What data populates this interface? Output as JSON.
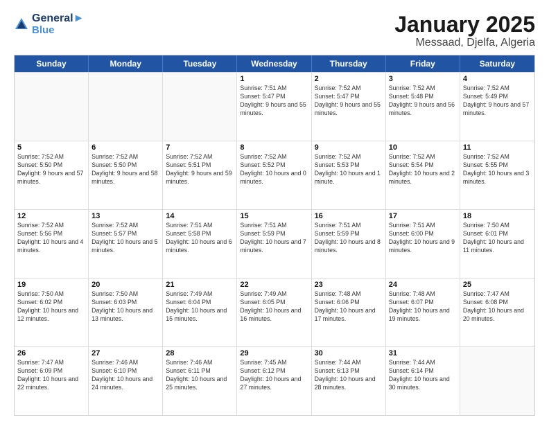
{
  "header": {
    "logo_line1": "General",
    "logo_line2": "Blue",
    "title": "January 2025",
    "subtitle": "Messaad, Djelfa, Algeria"
  },
  "weekdays": [
    "Sunday",
    "Monday",
    "Tuesday",
    "Wednesday",
    "Thursday",
    "Friday",
    "Saturday"
  ],
  "rows": [
    [
      {
        "day": "",
        "sunrise": "",
        "sunset": "",
        "daylight": ""
      },
      {
        "day": "",
        "sunrise": "",
        "sunset": "",
        "daylight": ""
      },
      {
        "day": "",
        "sunrise": "",
        "sunset": "",
        "daylight": ""
      },
      {
        "day": "1",
        "sunrise": "Sunrise: 7:51 AM",
        "sunset": "Sunset: 5:47 PM",
        "daylight": "Daylight: 9 hours and 55 minutes."
      },
      {
        "day": "2",
        "sunrise": "Sunrise: 7:52 AM",
        "sunset": "Sunset: 5:47 PM",
        "daylight": "Daylight: 9 hours and 55 minutes."
      },
      {
        "day": "3",
        "sunrise": "Sunrise: 7:52 AM",
        "sunset": "Sunset: 5:48 PM",
        "daylight": "Daylight: 9 hours and 56 minutes."
      },
      {
        "day": "4",
        "sunrise": "Sunrise: 7:52 AM",
        "sunset": "Sunset: 5:49 PM",
        "daylight": "Daylight: 9 hours and 57 minutes."
      }
    ],
    [
      {
        "day": "5",
        "sunrise": "Sunrise: 7:52 AM",
        "sunset": "Sunset: 5:50 PM",
        "daylight": "Daylight: 9 hours and 57 minutes."
      },
      {
        "day": "6",
        "sunrise": "Sunrise: 7:52 AM",
        "sunset": "Sunset: 5:50 PM",
        "daylight": "Daylight: 9 hours and 58 minutes."
      },
      {
        "day": "7",
        "sunrise": "Sunrise: 7:52 AM",
        "sunset": "Sunset: 5:51 PM",
        "daylight": "Daylight: 9 hours and 59 minutes."
      },
      {
        "day": "8",
        "sunrise": "Sunrise: 7:52 AM",
        "sunset": "Sunset: 5:52 PM",
        "daylight": "Daylight: 10 hours and 0 minutes."
      },
      {
        "day": "9",
        "sunrise": "Sunrise: 7:52 AM",
        "sunset": "Sunset: 5:53 PM",
        "daylight": "Daylight: 10 hours and 1 minute."
      },
      {
        "day": "10",
        "sunrise": "Sunrise: 7:52 AM",
        "sunset": "Sunset: 5:54 PM",
        "daylight": "Daylight: 10 hours and 2 minutes."
      },
      {
        "day": "11",
        "sunrise": "Sunrise: 7:52 AM",
        "sunset": "Sunset: 5:55 PM",
        "daylight": "Daylight: 10 hours and 3 minutes."
      }
    ],
    [
      {
        "day": "12",
        "sunrise": "Sunrise: 7:52 AM",
        "sunset": "Sunset: 5:56 PM",
        "daylight": "Daylight: 10 hours and 4 minutes."
      },
      {
        "day": "13",
        "sunrise": "Sunrise: 7:52 AM",
        "sunset": "Sunset: 5:57 PM",
        "daylight": "Daylight: 10 hours and 5 minutes."
      },
      {
        "day": "14",
        "sunrise": "Sunrise: 7:51 AM",
        "sunset": "Sunset: 5:58 PM",
        "daylight": "Daylight: 10 hours and 6 minutes."
      },
      {
        "day": "15",
        "sunrise": "Sunrise: 7:51 AM",
        "sunset": "Sunset: 5:59 PM",
        "daylight": "Daylight: 10 hours and 7 minutes."
      },
      {
        "day": "16",
        "sunrise": "Sunrise: 7:51 AM",
        "sunset": "Sunset: 5:59 PM",
        "daylight": "Daylight: 10 hours and 8 minutes."
      },
      {
        "day": "17",
        "sunrise": "Sunrise: 7:51 AM",
        "sunset": "Sunset: 6:00 PM",
        "daylight": "Daylight: 10 hours and 9 minutes."
      },
      {
        "day": "18",
        "sunrise": "Sunrise: 7:50 AM",
        "sunset": "Sunset: 6:01 PM",
        "daylight": "Daylight: 10 hours and 11 minutes."
      }
    ],
    [
      {
        "day": "19",
        "sunrise": "Sunrise: 7:50 AM",
        "sunset": "Sunset: 6:02 PM",
        "daylight": "Daylight: 10 hours and 12 minutes."
      },
      {
        "day": "20",
        "sunrise": "Sunrise: 7:50 AM",
        "sunset": "Sunset: 6:03 PM",
        "daylight": "Daylight: 10 hours and 13 minutes."
      },
      {
        "day": "21",
        "sunrise": "Sunrise: 7:49 AM",
        "sunset": "Sunset: 6:04 PM",
        "daylight": "Daylight: 10 hours and 15 minutes."
      },
      {
        "day": "22",
        "sunrise": "Sunrise: 7:49 AM",
        "sunset": "Sunset: 6:05 PM",
        "daylight": "Daylight: 10 hours and 16 minutes."
      },
      {
        "day": "23",
        "sunrise": "Sunrise: 7:48 AM",
        "sunset": "Sunset: 6:06 PM",
        "daylight": "Daylight: 10 hours and 17 minutes."
      },
      {
        "day": "24",
        "sunrise": "Sunrise: 7:48 AM",
        "sunset": "Sunset: 6:07 PM",
        "daylight": "Daylight: 10 hours and 19 minutes."
      },
      {
        "day": "25",
        "sunrise": "Sunrise: 7:47 AM",
        "sunset": "Sunset: 6:08 PM",
        "daylight": "Daylight: 10 hours and 20 minutes."
      }
    ],
    [
      {
        "day": "26",
        "sunrise": "Sunrise: 7:47 AM",
        "sunset": "Sunset: 6:09 PM",
        "daylight": "Daylight: 10 hours and 22 minutes."
      },
      {
        "day": "27",
        "sunrise": "Sunrise: 7:46 AM",
        "sunset": "Sunset: 6:10 PM",
        "daylight": "Daylight: 10 hours and 24 minutes."
      },
      {
        "day": "28",
        "sunrise": "Sunrise: 7:46 AM",
        "sunset": "Sunset: 6:11 PM",
        "daylight": "Daylight: 10 hours and 25 minutes."
      },
      {
        "day": "29",
        "sunrise": "Sunrise: 7:45 AM",
        "sunset": "Sunset: 6:12 PM",
        "daylight": "Daylight: 10 hours and 27 minutes."
      },
      {
        "day": "30",
        "sunrise": "Sunrise: 7:44 AM",
        "sunset": "Sunset: 6:13 PM",
        "daylight": "Daylight: 10 hours and 28 minutes."
      },
      {
        "day": "31",
        "sunrise": "Sunrise: 7:44 AM",
        "sunset": "Sunset: 6:14 PM",
        "daylight": "Daylight: 10 hours and 30 minutes."
      },
      {
        "day": "",
        "sunrise": "",
        "sunset": "",
        "daylight": ""
      }
    ]
  ]
}
